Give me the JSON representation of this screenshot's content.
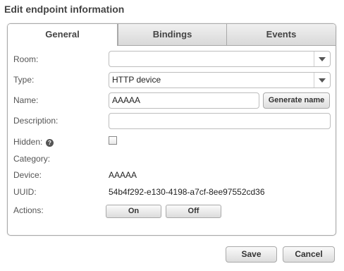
{
  "dialog": {
    "title": "Edit endpoint information"
  },
  "tabs": [
    {
      "label": "General",
      "active": true
    },
    {
      "label": "Bindings",
      "active": false
    },
    {
      "label": "Events",
      "active": false
    }
  ],
  "form": {
    "room": {
      "label": "Room:",
      "value": ""
    },
    "type": {
      "label": "Type:",
      "value": "HTTP device"
    },
    "name": {
      "label": "Name:",
      "value": "AAAAA",
      "generate_label": "Generate name"
    },
    "description": {
      "label": "Description:",
      "value": ""
    },
    "hidden": {
      "label": "Hidden:",
      "help_glyph": "?",
      "checked": false
    },
    "category": {
      "label": "Category:"
    },
    "device": {
      "label": "Device:",
      "value": "AAAAA"
    },
    "uuid": {
      "label": "UUID:",
      "value": "54b4f292-e130-4198-a7cf-8ee97552cd36"
    },
    "actions": {
      "label": "Actions:",
      "on_label": "On",
      "off_label": "Off"
    }
  },
  "footer": {
    "save_label": "Save",
    "cancel_label": "Cancel"
  },
  "icons": {
    "dropdown": "chevron-down-icon",
    "help": "help-icon"
  },
  "colors": {
    "border": "#a9a9a9",
    "tab_inactive": "#dedede",
    "text": "#333333"
  }
}
